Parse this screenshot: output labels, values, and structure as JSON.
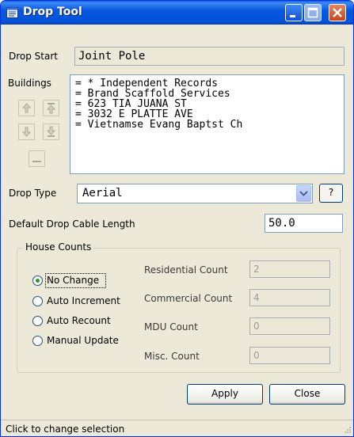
{
  "window": {
    "title": "Drop Tool"
  },
  "drop_start": {
    "label": "Drop Start",
    "value": "Joint Pole"
  },
  "buildings": {
    "label": "Buildings",
    "items": [
      "= * Independent Records",
      "= Brand Scaffold Services",
      "= 623 TIA JUANA ST",
      "= 3032 E PLATTE AVE",
      "= Vietnamse Evang Baptst Ch"
    ],
    "buttons": [
      "move-up",
      "move-top",
      "move-down",
      "move-bottom",
      "remove"
    ]
  },
  "drop_type": {
    "label": "Drop Type",
    "value": "Aerial",
    "help_label": "?"
  },
  "cable_length": {
    "label": "Default Drop Cable Length",
    "value": "50.0"
  },
  "house_counts": {
    "label": "House Counts",
    "options": [
      "No Change",
      "Auto Increment",
      "Auto Recount",
      "Manual Update"
    ],
    "selected": "No Change",
    "counts": [
      {
        "label": "Residential Count",
        "value": "2"
      },
      {
        "label": "Commercial Count",
        "value": "4"
      },
      {
        "label": "MDU Count",
        "value": "0"
      },
      {
        "label": "Misc. Count",
        "value": "0"
      }
    ]
  },
  "actions": {
    "apply": "Apply",
    "close": "Close"
  },
  "status": "Click to change selection",
  "colors": {
    "titlebar": "#0453d9",
    "window_bg": "#ece9d8",
    "radio_dot": "#21a121",
    "close_button": "#c8431e"
  },
  "icons": [
    "window-icon",
    "minimize-icon",
    "maximize-icon",
    "close-icon",
    "arrow-up-icon",
    "arrow-top-icon",
    "arrow-down-icon",
    "arrow-bottom-icon",
    "dash-icon",
    "chevron-down-icon",
    "resize-grip-icon"
  ]
}
